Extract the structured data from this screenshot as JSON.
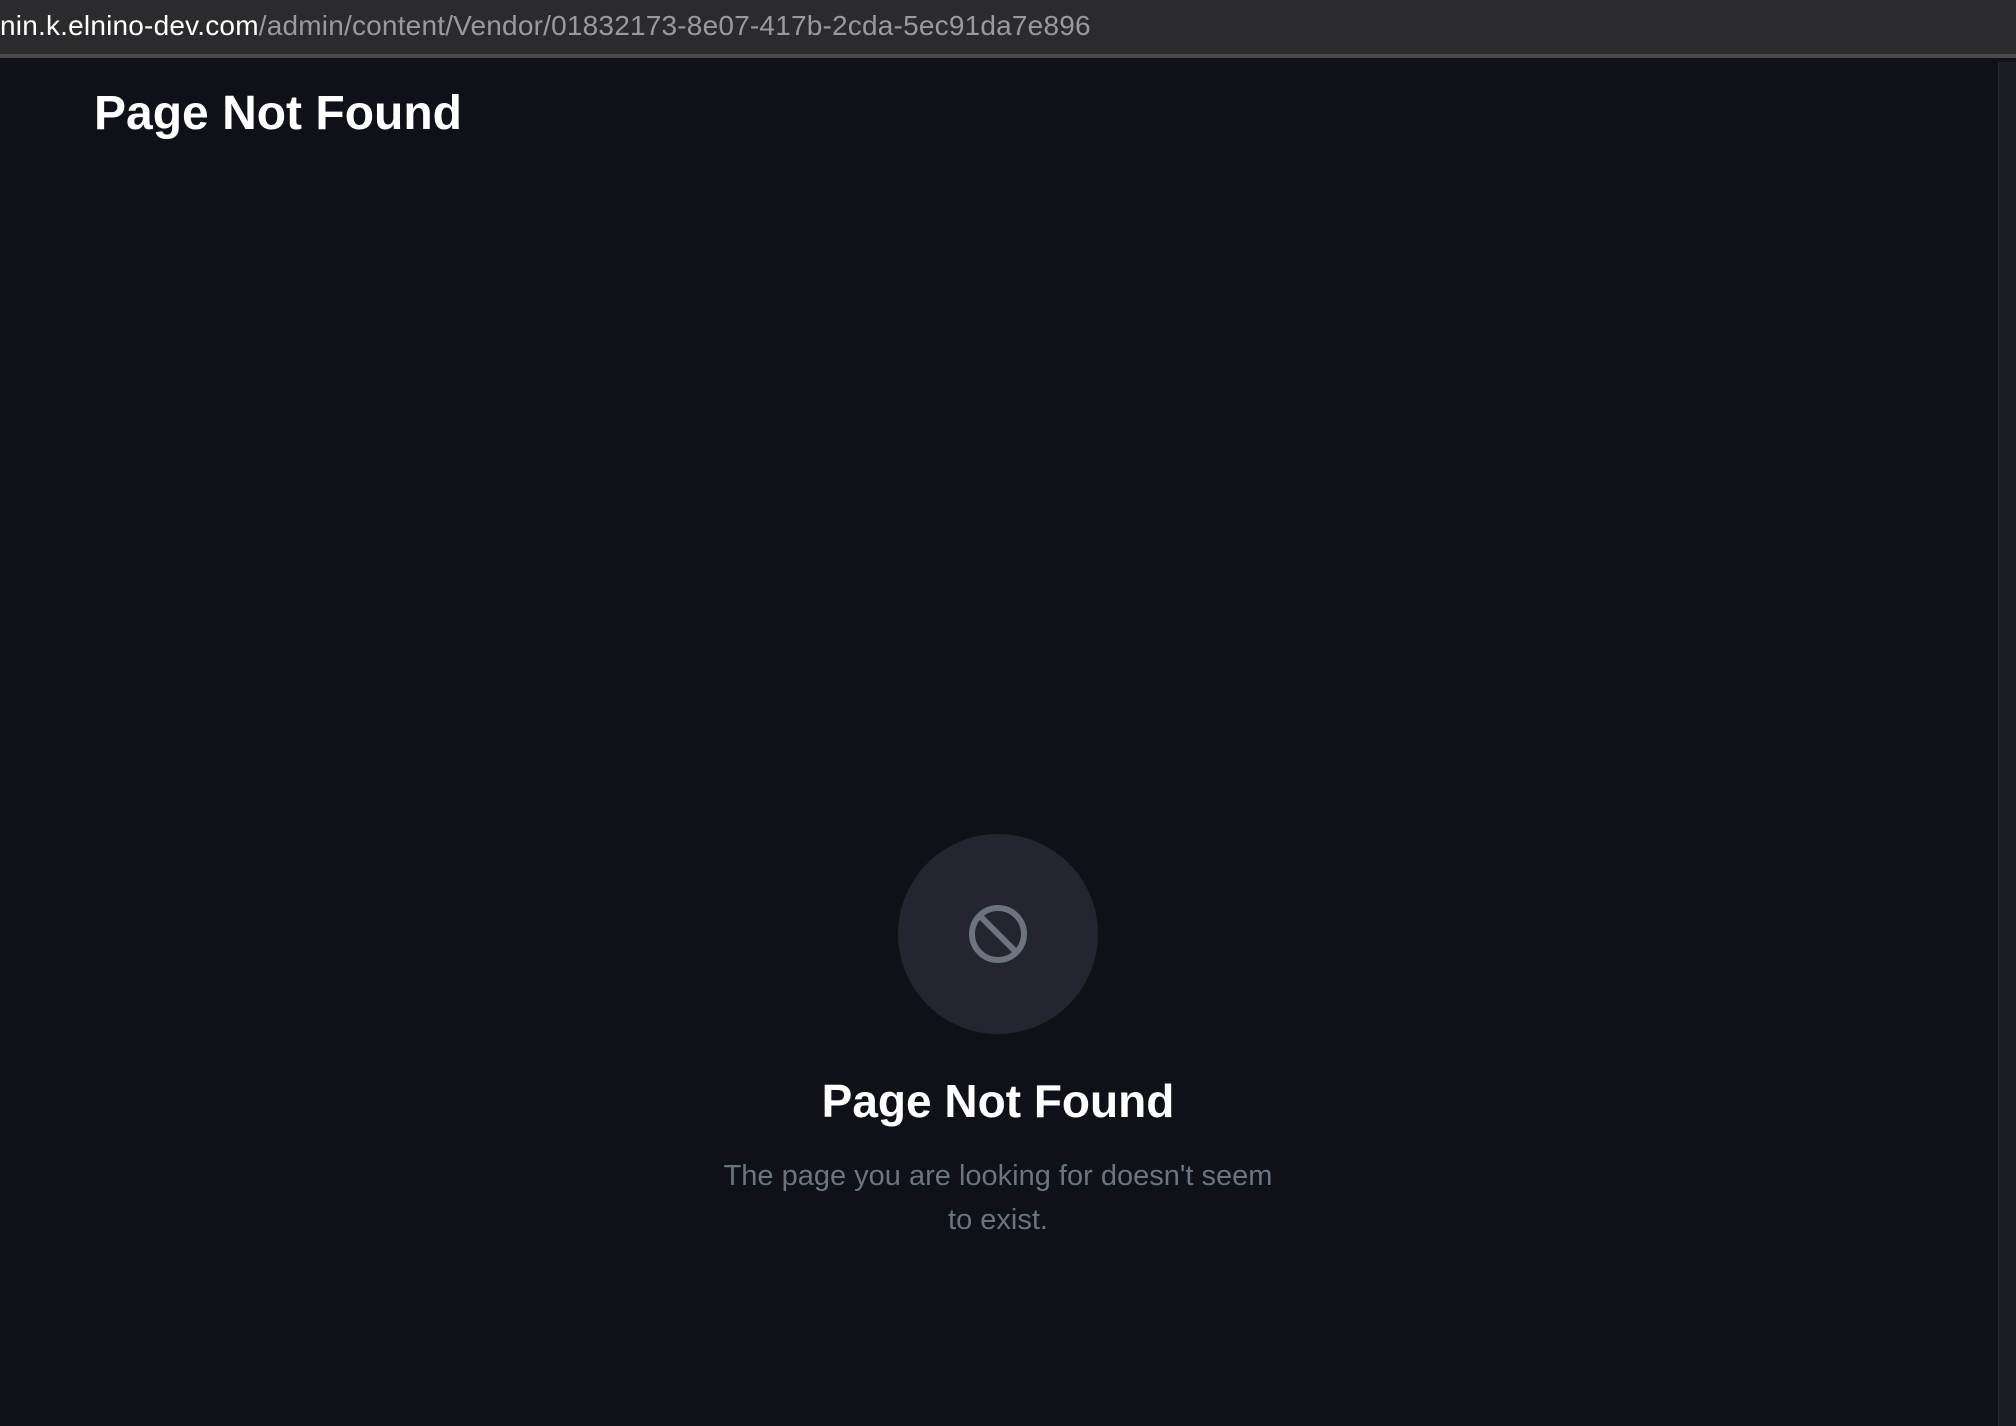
{
  "browser": {
    "url_host": "nin.k.elnino-dev.com",
    "url_path": "/admin/content/Vendor/01832173-8e07-417b-2cda-5ec91da7e896"
  },
  "header": {
    "title": "Page Not Found"
  },
  "empty_state": {
    "icon": "block-icon",
    "title": "Page Not Found",
    "description": "The page you are looking for doesn't seem to exist."
  },
  "colors": {
    "background": "#0e1117",
    "icon_circle": "#23262e",
    "icon": "#6e7380",
    "muted_text": "#6e7380"
  }
}
